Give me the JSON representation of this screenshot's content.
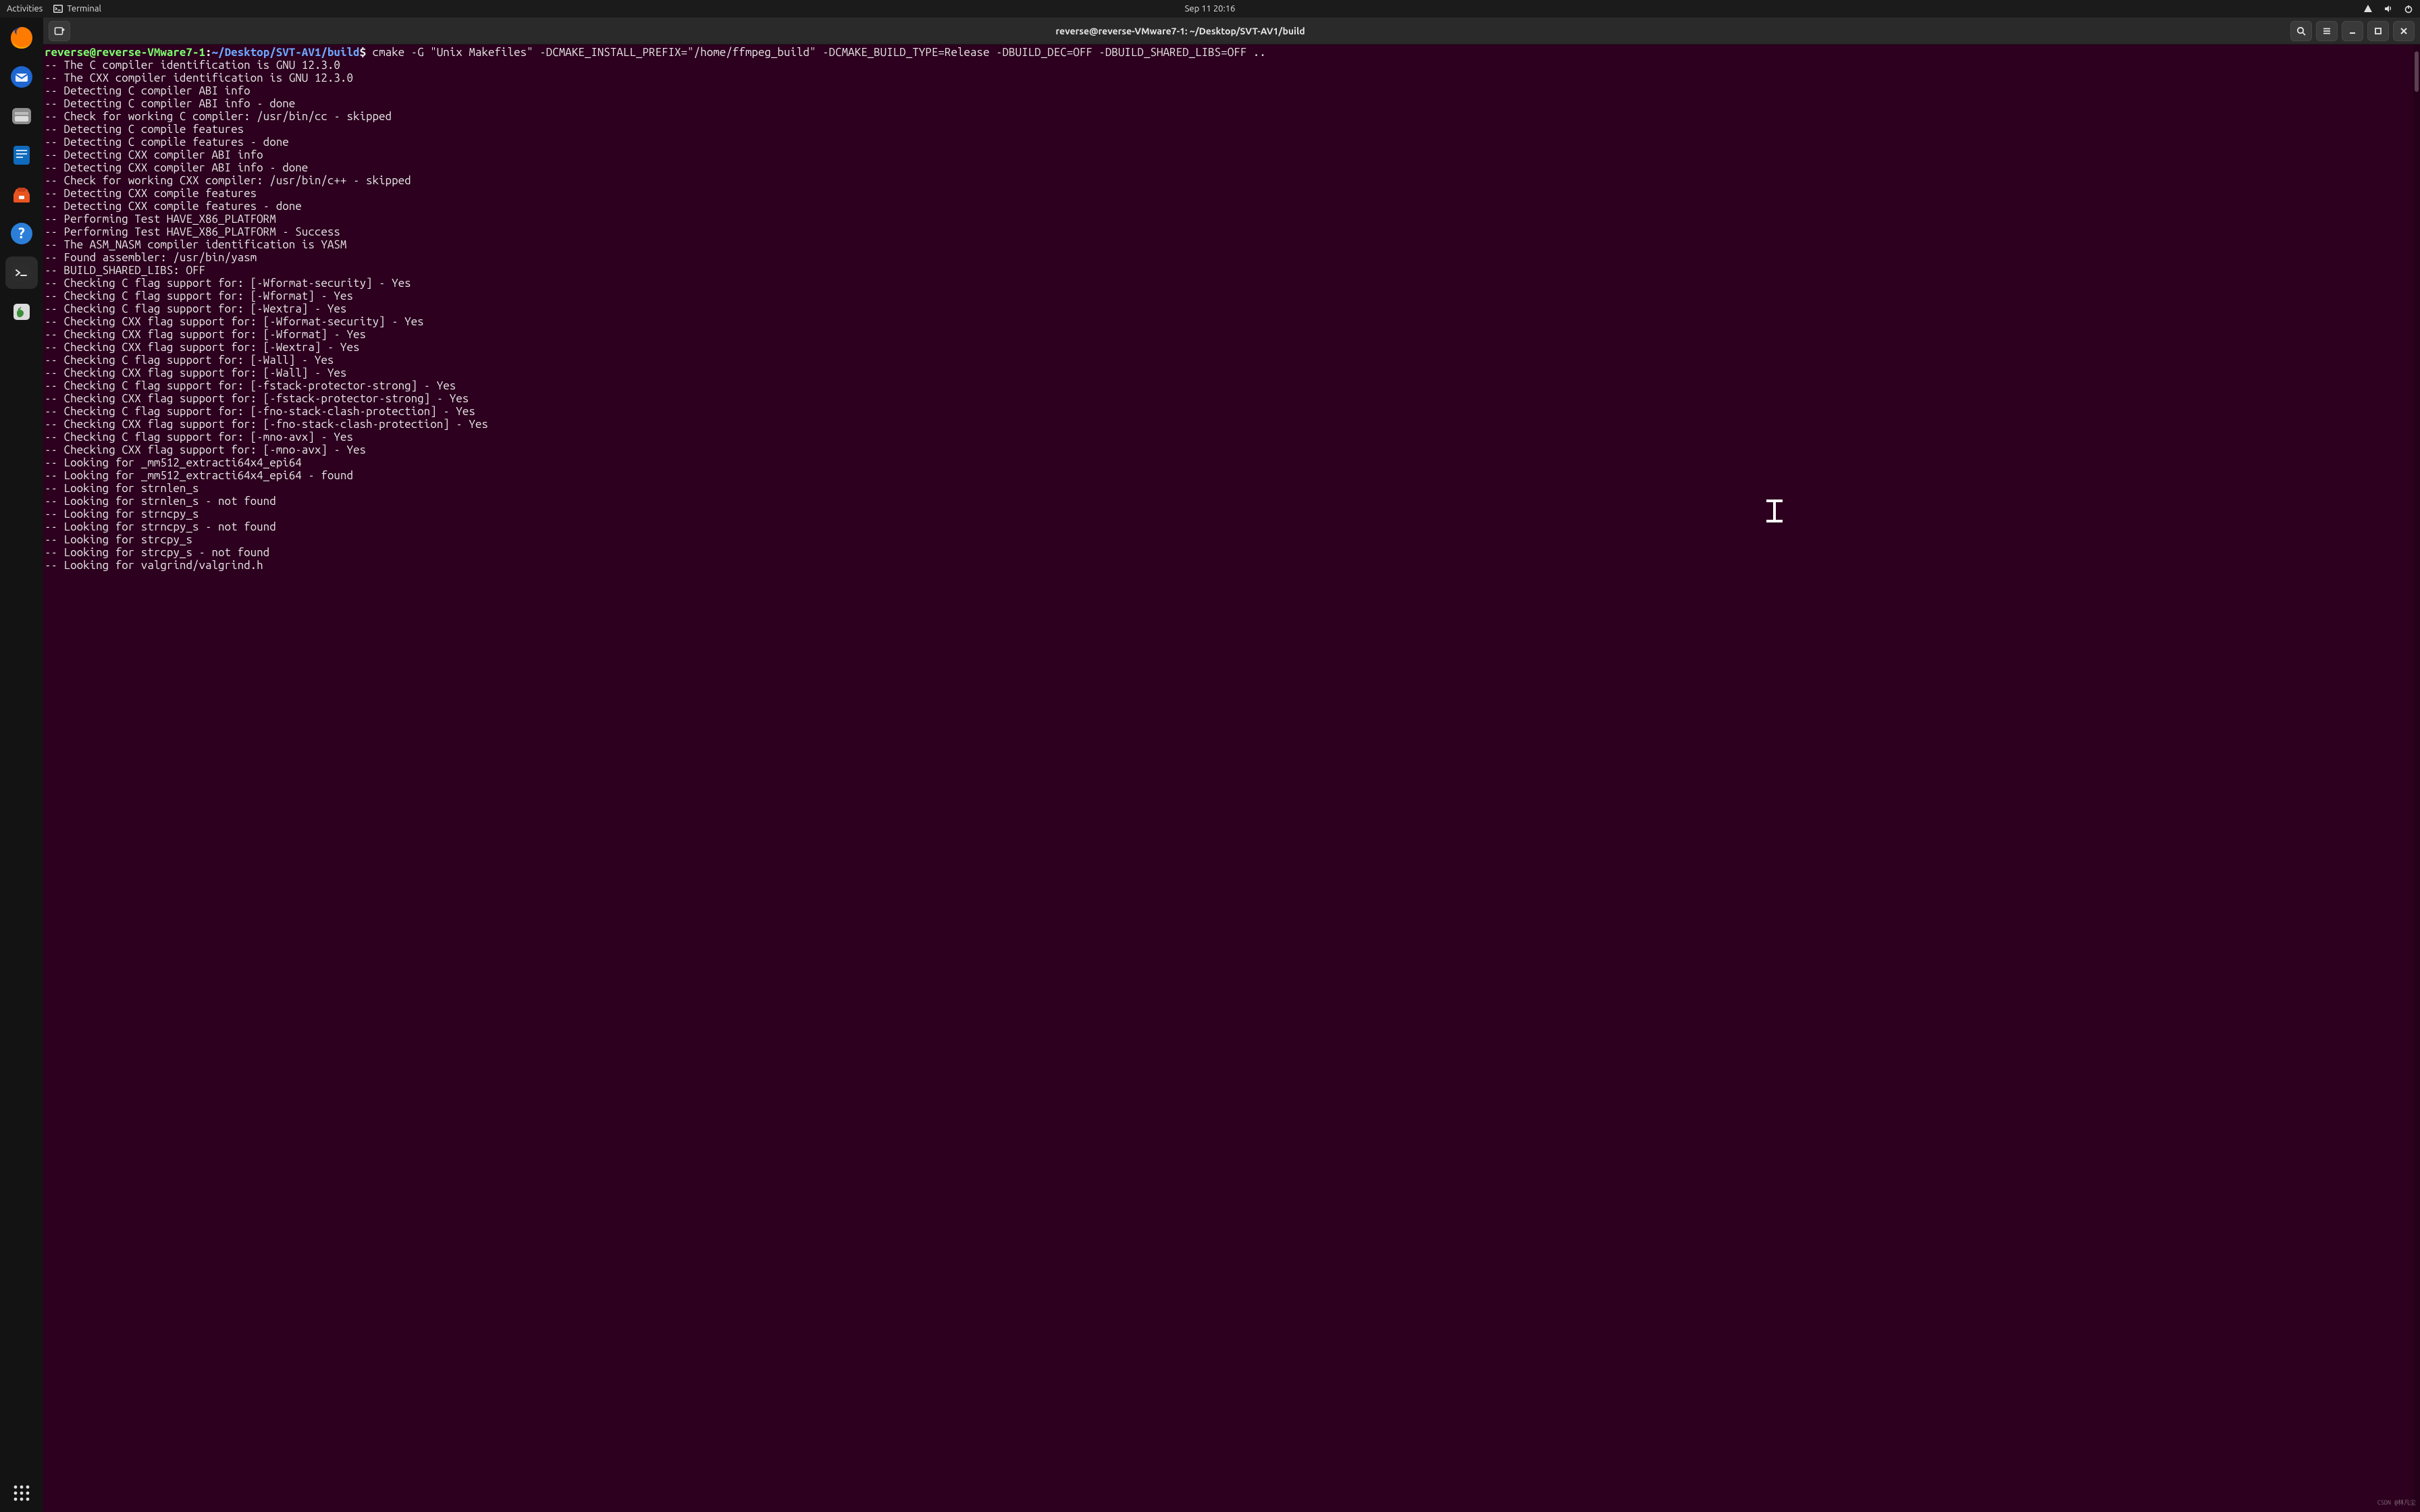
{
  "topbar": {
    "activities": "Activities",
    "app_name": "Terminal",
    "datetime": "Sep 11  20:16"
  },
  "dock": {
    "items": [
      {
        "name": "firefox",
        "active": false
      },
      {
        "name": "thunderbird",
        "active": false
      },
      {
        "name": "files",
        "active": false
      },
      {
        "name": "writer",
        "active": false
      },
      {
        "name": "software",
        "active": false
      },
      {
        "name": "help",
        "active": false
      },
      {
        "name": "terminal",
        "active": true
      },
      {
        "name": "trash",
        "active": false
      }
    ]
  },
  "headerbar": {
    "title": "reverse@reverse-VMware7-1: ~/Desktop/SVT-AV1/build"
  },
  "prompt": {
    "user_host": "reverse@reverse-VMware7-1",
    "colon": ":",
    "path": "~/Desktop/SVT-AV1/build",
    "dollar": "$ ",
    "command": "cmake -G \"Unix Makefiles\" -DCMAKE_INSTALL_PREFIX=\"/home/ffmpeg_build\" -DCMAKE_BUILD_TYPE=Release -DBUILD_DEC=OFF -DBUILD_SHARED_LIBS=OFF .."
  },
  "output_lines": [
    "-- The C compiler identification is GNU 12.3.0",
    "-- The CXX compiler identification is GNU 12.3.0",
    "-- Detecting C compiler ABI info",
    "-- Detecting C compiler ABI info - done",
    "-- Check for working C compiler: /usr/bin/cc - skipped",
    "-- Detecting C compile features",
    "-- Detecting C compile features - done",
    "-- Detecting CXX compiler ABI info",
    "-- Detecting CXX compiler ABI info - done",
    "-- Check for working CXX compiler: /usr/bin/c++ - skipped",
    "-- Detecting CXX compile features",
    "-- Detecting CXX compile features - done",
    "-- Performing Test HAVE_X86_PLATFORM",
    "-- Performing Test HAVE_X86_PLATFORM - Success",
    "-- The ASM_NASM compiler identification is YASM",
    "-- Found assembler: /usr/bin/yasm",
    "-- BUILD_SHARED_LIBS: OFF",
    "-- Checking C flag support for: [-Wformat-security] - Yes",
    "-- Checking C flag support for: [-Wformat] - Yes",
    "-- Checking C flag support for: [-Wextra] - Yes",
    "-- Checking CXX flag support for: [-Wformat-security] - Yes",
    "-- Checking CXX flag support for: [-Wformat] - Yes",
    "-- Checking CXX flag support for: [-Wextra] - Yes",
    "-- Checking C flag support for: [-Wall] - Yes",
    "-- Checking CXX flag support for: [-Wall] - Yes",
    "-- Checking C flag support for: [-fstack-protector-strong] - Yes",
    "-- Checking CXX flag support for: [-fstack-protector-strong] - Yes",
    "-- Checking C flag support for: [-fno-stack-clash-protection] - Yes",
    "-- Checking CXX flag support for: [-fno-stack-clash-protection] - Yes",
    "-- Checking C flag support for: [-mno-avx] - Yes",
    "-- Checking CXX flag support for: [-mno-avx] - Yes",
    "-- Looking for _mm512_extracti64x4_epi64",
    "-- Looking for _mm512_extracti64x4_epi64 - found",
    "-- Looking for strnlen_s",
    "-- Looking for strnlen_s - not found",
    "-- Looking for strncpy_s",
    "-- Looking for strncpy_s - not found",
    "-- Looking for strcpy_s",
    "-- Looking for strcpy_s - not found",
    "-- Looking for valgrind/valgrind.h"
  ],
  "watermark": "CSDN @林凡尘"
}
